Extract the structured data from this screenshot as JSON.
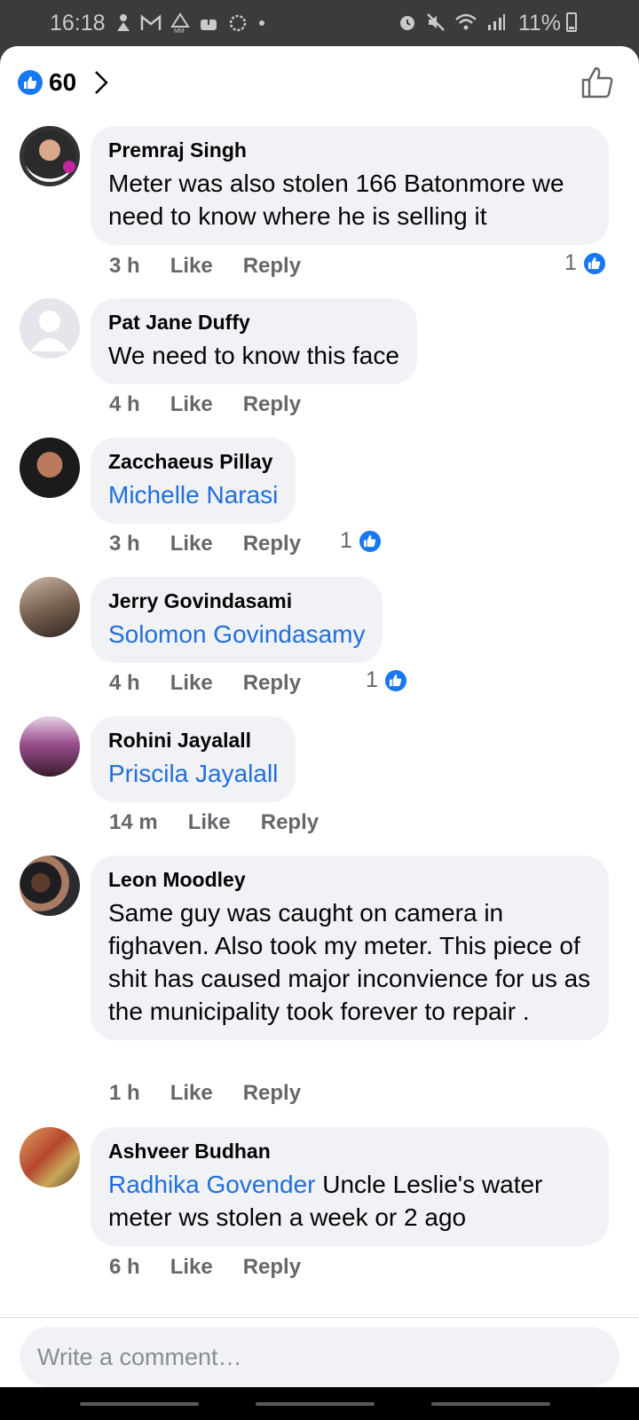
{
  "status_bar": {
    "time": "16:18",
    "battery_pct": "11%",
    "left_icons": [
      "upload-icon",
      "gmail-icon",
      "mm-alert-icon",
      "cloud-download-icon",
      "settings-dotted-icon",
      "dot-icon"
    ],
    "right_icons": [
      "alarm-icon",
      "mute-icon",
      "wifi-icon",
      "signal-icon"
    ]
  },
  "header": {
    "reaction_count": "60",
    "icons": [
      "like-badge-icon",
      "chevron-right-icon",
      "like-outline-icon"
    ]
  },
  "comments": [
    {
      "author": "Premraj Singh",
      "body": "Meter was also stolen 166 Batonmore we need to know where he is selling it",
      "time": "3 h",
      "like": "Like",
      "reply": "Reply",
      "reactions": "1"
    },
    {
      "author": "Pat Jane Duffy",
      "body": "We need to know this face",
      "time": "4 h",
      "like": "Like",
      "reply": "Reply"
    },
    {
      "author": "Zacchaeus Pillay",
      "mention": "Michelle Narasi",
      "time": "3 h",
      "like": "Like",
      "reply": "Reply",
      "reactions": "1"
    },
    {
      "author": "Jerry Govindasami",
      "mention": "Solomon Govindasamy",
      "time": "4 h",
      "like": "Like",
      "reply": "Reply",
      "reactions": "1"
    },
    {
      "author": "Rohini Jayalall",
      "mention": "Priscila Jayalall",
      "time": "14 m",
      "like": "Like",
      "reply": "Reply"
    },
    {
      "author": "Leon Moodley",
      "body": "Same guy was caught on camera in fighaven.  Also took my meter.  This piece of shit has caused major inconvience for us as the municipality took forever to repair .",
      "time": "1 h",
      "like": "Like",
      "reply": "Reply"
    },
    {
      "author": "Ashveer Budhan",
      "mention": "Radhika Govender",
      "body": " Uncle Leslie's water meter ws stolen a week or 2 ago",
      "time": "6 h",
      "like": "Like",
      "reply": "Reply"
    }
  ],
  "composer": {
    "placeholder": "Write a comment…"
  },
  "colors": {
    "accent": "#1877f2",
    "mention": "#216fdb",
    "bubble": "#f0f2f5",
    "meta": "#65676b"
  }
}
